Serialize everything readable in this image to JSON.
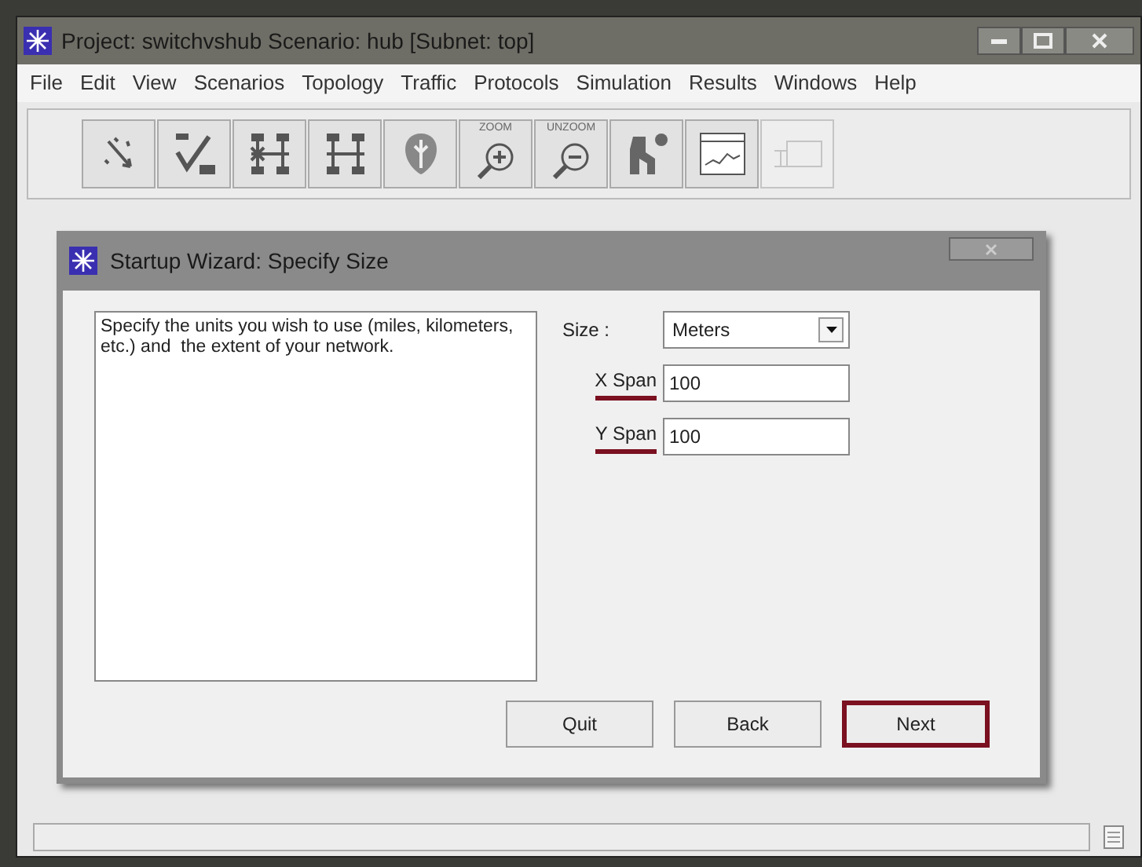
{
  "window": {
    "title": "Project: switchvshub Scenario: hub  [Subnet: top]"
  },
  "menu": [
    "File",
    "Edit",
    "View",
    "Scenarios",
    "Topology",
    "Traffic",
    "Protocols",
    "Simulation",
    "Results",
    "Windows",
    "Help"
  ],
  "toolbar": [
    {
      "kind": "wand",
      "disabled": false
    },
    {
      "kind": "verify",
      "disabled": false
    },
    {
      "kind": "failnodes",
      "disabled": false
    },
    {
      "kind": "recovernodes",
      "disabled": false
    },
    {
      "kind": "shield",
      "disabled": false
    },
    {
      "kind": "zoom",
      "caption": "ZOOM",
      "disabled": false
    },
    {
      "kind": "unzoom",
      "caption": "UNZOOM",
      "disabled": false
    },
    {
      "kind": "run",
      "disabled": false
    },
    {
      "kind": "graph",
      "disabled": false
    },
    {
      "kind": "hide",
      "disabled": true
    }
  ],
  "dialog": {
    "title": "Startup Wizard: Specify Size",
    "description": "Specify the units you wish to use (miles, kilometers, etc.) and  the extent of your network.",
    "size": {
      "label": "Size :",
      "value": "Meters"
    },
    "fields": [
      {
        "label": "X Span",
        "value": "100",
        "marked": true
      },
      {
        "label": "Y Span",
        "value": "100",
        "marked": true
      }
    ],
    "buttons": [
      {
        "label": "Quit",
        "highlighted": false
      },
      {
        "label": "Back",
        "highlighted": false
      },
      {
        "label": "Next",
        "highlighted": true
      }
    ]
  }
}
